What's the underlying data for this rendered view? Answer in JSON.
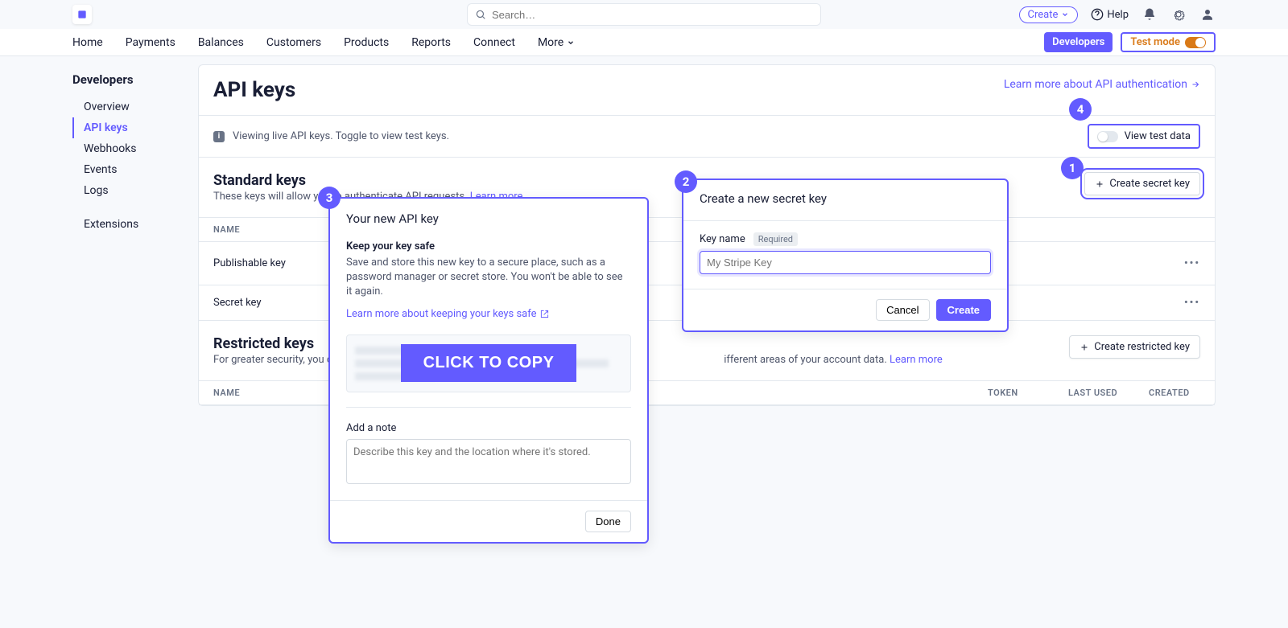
{
  "topbar": {
    "search_placeholder": "Search…",
    "create_label": "Create",
    "help_label": "Help"
  },
  "nav": {
    "items": [
      "Home",
      "Payments",
      "Balances",
      "Customers",
      "Products",
      "Reports",
      "Connect",
      "More"
    ],
    "developers_label": "Developers",
    "testmode_label": "Test mode"
  },
  "sidebar": {
    "title": "Developers",
    "group1": [
      "Overview",
      "API keys",
      "Webhooks",
      "Events",
      "Logs"
    ],
    "group2": [
      "Extensions"
    ],
    "active": "API keys"
  },
  "page": {
    "title": "API keys",
    "learn_link": "Learn more about API authentication",
    "notice": "Viewing live API keys. Toggle to view test keys.",
    "view_test_label": "View test data"
  },
  "standard": {
    "title": "Standard keys",
    "subtitle": "These keys will allow you to authenticate API requests.",
    "learn_more": "Learn more",
    "create_btn": "Create secret key",
    "col_name": "NAME",
    "rows": [
      "Publishable key",
      "Secret key"
    ]
  },
  "restricted": {
    "title": "Restricted keys",
    "subtitle_part1": "For greater security, you c",
    "subtitle_part2": "ifferent areas of your account data.",
    "learn_more": "Learn more",
    "create_btn": "Create restricted key",
    "cols": [
      "NAME",
      "TOKEN",
      "LAST USED",
      "CREATED"
    ]
  },
  "badges": {
    "b1": "1",
    "b2": "2",
    "b3": "3",
    "b4": "4"
  },
  "popup2": {
    "title": "Create a new secret key",
    "field_label": "Key name",
    "required": "Required",
    "placeholder": "My Stripe Key",
    "cancel": "Cancel",
    "create": "Create"
  },
  "popup3": {
    "title": "Your new API key",
    "sub": "Keep your key safe",
    "body": "Save and store this new key to a secure place, such as a password manager or secret store. You won't be able to see it again.",
    "link": "Learn more about keeping your keys safe",
    "copy": "CLICK TO COPY",
    "note_label": "Add a note",
    "note_placeholder": "Describe this key and the location where it's stored.",
    "done": "Done"
  }
}
